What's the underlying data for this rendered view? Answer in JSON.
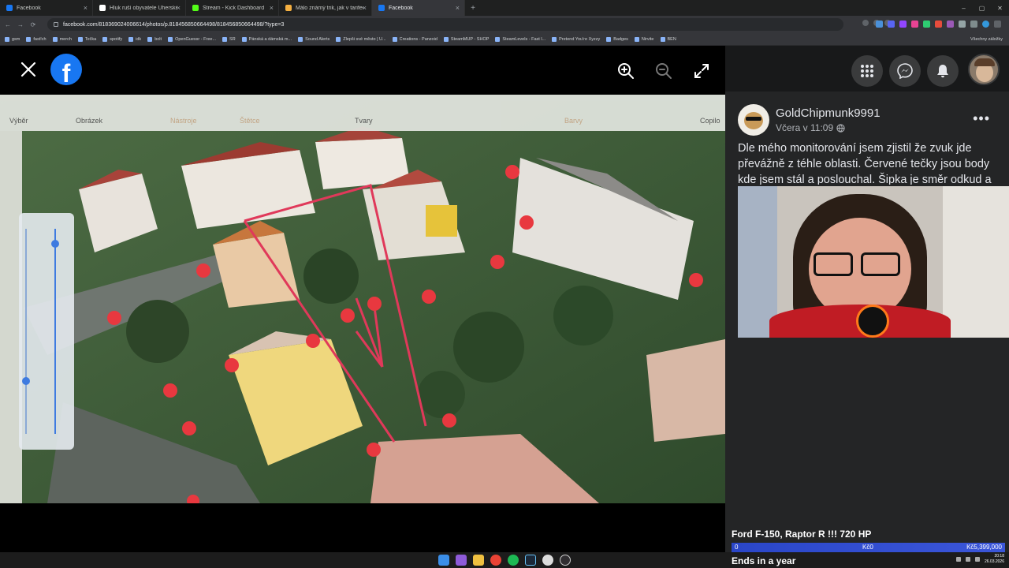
{
  "browser": {
    "tabs": [
      {
        "label": "Facebook",
        "color": "#1877f2",
        "active": false
      },
      {
        "label": "Hluk ruší obyvatele Uherského",
        "color": "#ffffff",
        "active": false
      },
      {
        "label": "Stream - Kick Dashboard",
        "color": "#53fc18",
        "active": false
      },
      {
        "label": "Málo známý trik, jak v tarifech",
        "color": "#f5b041",
        "active": false
      },
      {
        "label": "Facebook",
        "color": "#1877f2",
        "active": true
      }
    ],
    "close_glyph": "×",
    "new_tab_glyph": "+",
    "window_controls": [
      "–",
      "▢",
      "✕"
    ],
    "nav": [
      "←",
      "→",
      "⟳"
    ],
    "url": "facebook.com/818369024006614/photos/p.818456850664498/818456850664498/?type=3",
    "bookmarks": [
      "gsm",
      "fast!ch",
      "merch",
      "Tečka",
      "spotify",
      "idk",
      "bolt",
      "OpenGuessr - Free...",
      "SR",
      "Pánská a dámská m...",
      "Sound Alerts",
      "Zlepši své město | U...",
      "Creations - Panzoid",
      "SteamMUP - SHOP",
      "SteamLevels - Fast l...",
      "Pretend You're Xyzzy",
      "Badges",
      "Nirvite",
      "BEN"
    ],
    "all_bookmarks": "Všechny záložky"
  },
  "viewer": {
    "close_icon": "close-icon",
    "zoom_in_icon": "zoom-in-icon",
    "zoom_out_icon": "zoom-out-icon",
    "fullscreen_icon": "fullscreen-icon",
    "photo_toolbar_labels": {
      "select": "Výběr",
      "image": "Obrázek",
      "tools": "Nástroje",
      "brushes": "Štětce",
      "shapes": "Tvary",
      "colors": "Barvy",
      "copilot": "Copilo"
    }
  },
  "post": {
    "author": "GoldChipmunk9991",
    "time": "Včera v 11:09",
    "text": "Dle mého monitorování jsem zjistil že zvuk jde převážně z téhle oblasti. Červené tečky jsou body kde jsem stál a poslouchal. Šipka je směr odkud a",
    "more_glyph": "•••"
  },
  "overlay": {
    "ticker_title": "Ford F-150, Raptor R !!! 720 HP",
    "ticker_left": "0",
    "ticker_mid": "Kč0",
    "ticker_right": "Kč5,399,000",
    "ends": "Ends in a year"
  },
  "taskbar": {
    "time": "20:18",
    "date": "26.03.2026"
  },
  "colors": {
    "accent": "#1877f2",
    "panel": "#242526",
    "marker": "#e8383f"
  }
}
